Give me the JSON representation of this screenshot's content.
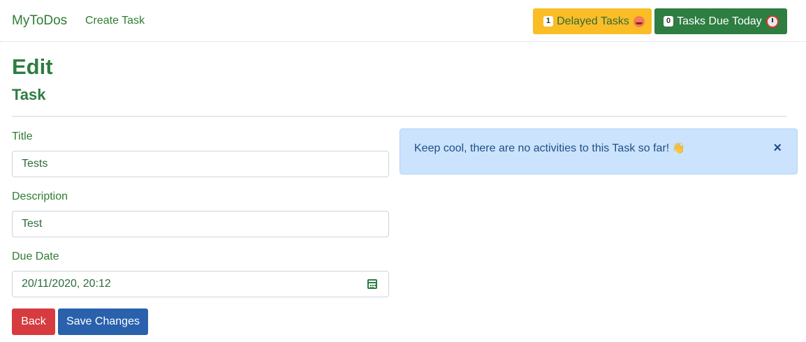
{
  "navbar": {
    "brand": "MyToDos",
    "create_task_link": "Create Task",
    "delayed": {
      "count": "1",
      "label": "Delayed Tasks",
      "color": "#fbbd25",
      "icon": "angry-face-icon"
    },
    "due_today": {
      "count": "0",
      "label": "Tasks Due Today",
      "color": "#2e7d41",
      "icon": "alarm-clock-icon"
    }
  },
  "page": {
    "title": "Edit",
    "subtitle": "Task"
  },
  "form": {
    "title_label": "Title",
    "title_value": "Tests",
    "description_label": "Description",
    "description_value": "Test",
    "due_date_label": "Due Date",
    "due_date_value": "20/11/2020, 20:12",
    "back_button": "Back",
    "save_button": "Save Changes"
  },
  "alert": {
    "message": "Keep cool, there are no activities to this Task so far!",
    "icon": "waving-hand-icon",
    "close": "×",
    "color": "#cbe3fd"
  }
}
